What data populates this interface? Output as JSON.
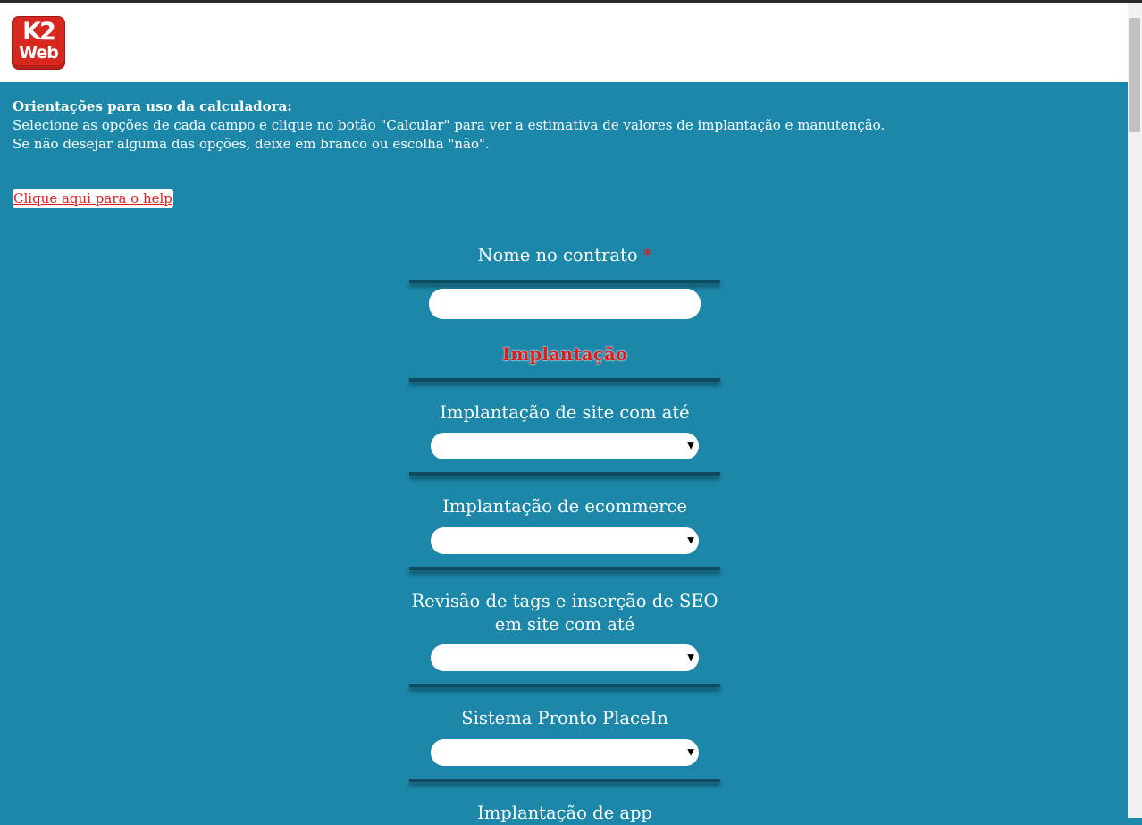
{
  "logo": {
    "line1": "K2",
    "line2": "Web"
  },
  "intro": {
    "heading": "Orientações para uso da calculadora:",
    "line1": "Selecione as opções de cada campo e clique no botão \"Calcular\" para ver a estimativa de valores de implantação e manutenção.",
    "line2": "Se não desejar alguma das opções, deixe em branco ou escolha \"não\"."
  },
  "help_link": "Clique aqui para o help",
  "form": {
    "name_label": "Nome no contrato",
    "required_mark": "*",
    "name_value": "",
    "section_implantacao": "Implantação",
    "site_label": "Implantação de site com até",
    "site_selected": "",
    "ecommerce_label": "Implantação de ecommerce",
    "ecommerce_selected": "",
    "seo_label_line1": "Revisão de tags e inserção de SEO",
    "seo_label_line2": "em site com até",
    "seo_selected": "",
    "placein_label": "Sistema Pronto PlaceIn",
    "placein_selected": "",
    "app_label": "Implantação de app"
  },
  "colors": {
    "background": "#1c87a9",
    "accent_red": "#e01b1b",
    "logo_red": "#d6281f"
  }
}
